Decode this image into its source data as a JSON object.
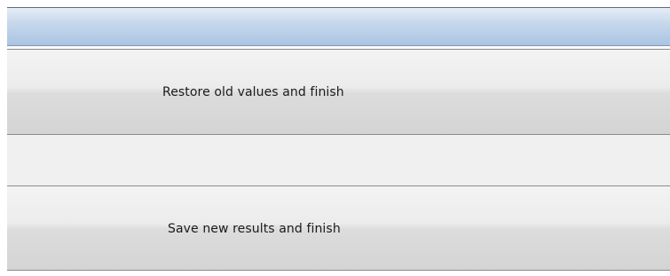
{
  "window": {
    "title": ""
  },
  "actions": {
    "restore_label": "Restore old values and finish",
    "save_label": "Save new results and finish"
  },
  "colors": {
    "title_bar_top": "#e6edf6",
    "title_bar_bottom": "#aac4e2",
    "button_face": "#ececec",
    "button_border": "#8a8a8a",
    "panel_background": "#f0f0f0"
  }
}
